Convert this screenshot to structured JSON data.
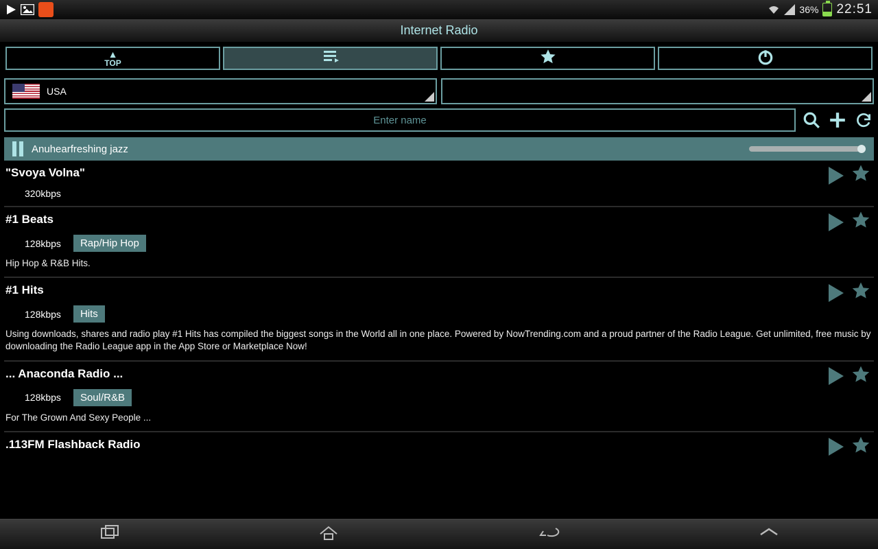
{
  "statusbar": {
    "battery_text": "36%",
    "clock": "22:51"
  },
  "header": {
    "title": "Internet Radio"
  },
  "tabs": {
    "top_label": "TOP"
  },
  "filter": {
    "country": "USA"
  },
  "search": {
    "placeholder": "Enter name"
  },
  "nowplaying": {
    "title": "Anuhearfreshing jazz"
  },
  "stations": [
    {
      "title": "\"Svoya Volna\"",
      "bitrate": "320kbps",
      "genre": "",
      "desc": ""
    },
    {
      "title": "#1 Beats",
      "bitrate": "128kbps",
      "genre": "Rap/Hip Hop",
      "desc": "Hip Hop & R&B Hits."
    },
    {
      "title": "#1 Hits",
      "bitrate": "128kbps",
      "genre": "Hits",
      "desc": "Using downloads, shares and radio play #1 Hits has compiled the biggest songs in the World all in one place. Powered by NowTrending.com and a proud partner of the Radio League. Get unlimited, free music by downloading the Radio League app in the App Store or Marketplace Now!"
    },
    {
      "title": "... Anaconda Radio ...",
      "bitrate": "128kbps",
      "genre": "Soul/R&B",
      "desc": "For The Grown And Sexy People ..."
    },
    {
      "title": ".113FM Flashback Radio",
      "bitrate": "",
      "genre": "",
      "desc": ""
    }
  ]
}
